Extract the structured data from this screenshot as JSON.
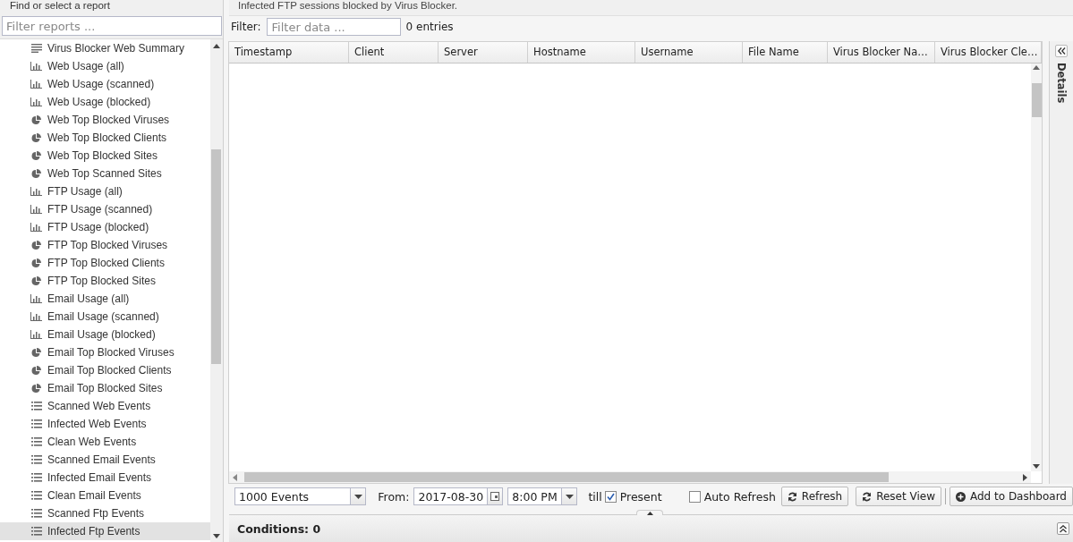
{
  "sidebar": {
    "title": "Find or select a report",
    "filter": {
      "placeholder": "Filter reports ..."
    },
    "items": [
      {
        "label": "Virus Blocker Web Summary",
        "kind": "text",
        "selected": false
      },
      {
        "label": "Web Usage (all)",
        "kind": "bar",
        "selected": false
      },
      {
        "label": "Web Usage (scanned)",
        "kind": "bar",
        "selected": false
      },
      {
        "label": "Web Usage (blocked)",
        "kind": "bar",
        "selected": false
      },
      {
        "label": "Web Top Blocked Viruses",
        "kind": "pie",
        "selected": false
      },
      {
        "label": "Web Top Blocked Clients",
        "kind": "pie",
        "selected": false
      },
      {
        "label": "Web Top Blocked Sites",
        "kind": "pie",
        "selected": false
      },
      {
        "label": "Web Top Scanned Sites",
        "kind": "pie",
        "selected": false
      },
      {
        "label": "FTP Usage (all)",
        "kind": "bar",
        "selected": false
      },
      {
        "label": "FTP Usage (scanned)",
        "kind": "bar",
        "selected": false
      },
      {
        "label": "FTP Usage (blocked)",
        "kind": "bar",
        "selected": false
      },
      {
        "label": "FTP Top Blocked Viruses",
        "kind": "pie",
        "selected": false
      },
      {
        "label": "FTP Top Blocked Clients",
        "kind": "pie",
        "selected": false
      },
      {
        "label": "FTP Top Blocked Sites",
        "kind": "pie",
        "selected": false
      },
      {
        "label": "Email Usage (all)",
        "kind": "bar",
        "selected": false
      },
      {
        "label": "Email Usage (scanned)",
        "kind": "bar",
        "selected": false
      },
      {
        "label": "Email Usage (blocked)",
        "kind": "bar",
        "selected": false
      },
      {
        "label": "Email Top Blocked Viruses",
        "kind": "pie",
        "selected": false
      },
      {
        "label": "Email Top Blocked Clients",
        "kind": "pie",
        "selected": false
      },
      {
        "label": "Email Top Blocked Sites",
        "kind": "pie",
        "selected": false
      },
      {
        "label": "Scanned Web Events",
        "kind": "list",
        "selected": false
      },
      {
        "label": "Infected Web Events",
        "kind": "list",
        "selected": false
      },
      {
        "label": "Clean Web Events",
        "kind": "list",
        "selected": false
      },
      {
        "label": "Scanned Email Events",
        "kind": "list",
        "selected": false
      },
      {
        "label": "Infected Email Events",
        "kind": "list",
        "selected": false
      },
      {
        "label": "Clean Email Events",
        "kind": "list",
        "selected": false
      },
      {
        "label": "Scanned Ftp Events",
        "kind": "list",
        "selected": false
      },
      {
        "label": "Infected Ftp Events",
        "kind": "list",
        "selected": true
      }
    ]
  },
  "report": {
    "description": "Infected FTP sessions blocked by Virus Blocker.",
    "filter": {
      "label": "Filter:",
      "placeholder": "Filter data ..."
    },
    "entries": "0 entries",
    "columns": [
      "Timestamp",
      "Client",
      "Server",
      "Hostname",
      "Username",
      "File Name",
      "Virus Blocker Na…",
      "Virus Blocker Cle…"
    ],
    "details_label": "Details"
  },
  "toolbar": {
    "limit": "1000 Events",
    "from_label": "From:",
    "date": "2017-08-30",
    "time": "8:00 PM",
    "till_label": "till",
    "present": {
      "label": "Present",
      "checked": true
    },
    "auto_refresh": {
      "label": "Auto Refresh",
      "checked": false
    },
    "buttons": [
      {
        "label": "Refresh",
        "kind": "refresh"
      },
      {
        "label": "Reset View",
        "kind": "refresh"
      },
      {
        "label": "Add to Dashboard",
        "kind": "add"
      }
    ]
  },
  "conditions": "Conditions: 0"
}
